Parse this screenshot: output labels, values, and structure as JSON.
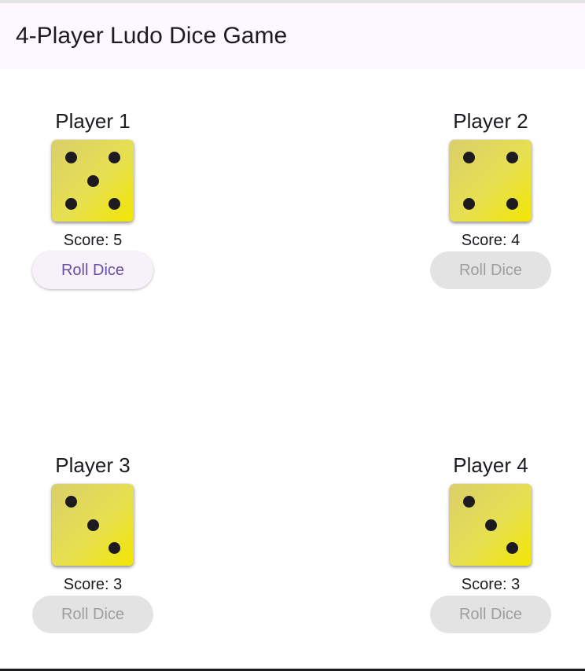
{
  "app": {
    "title": "4-Player Ludo Dice Game"
  },
  "players": [
    {
      "name": "Player 1",
      "die_value": 5,
      "score_text": "Score: 5",
      "button_label": "Roll Dice",
      "button_enabled": true
    },
    {
      "name": "Player 2",
      "die_value": 4,
      "score_text": "Score: 4",
      "button_label": "Roll Dice",
      "button_enabled": false
    },
    {
      "name": "Player 3",
      "die_value": 3,
      "score_text": "Score: 3",
      "button_label": "Roll Dice",
      "button_enabled": false
    },
    {
      "name": "Player 4",
      "die_value": 3,
      "score_text": "Score: 3",
      "button_label": "Roll Dice",
      "button_enabled": false
    }
  ],
  "colors": {
    "app_bar_background": "#fdf7ff",
    "die_gradient_start": "#d9cf6a",
    "die_gradient_end": "#f2e600",
    "pip": "#1d1b20",
    "button_enabled_text": "#6750a4",
    "button_enabled_background": "#f7f2fa",
    "button_disabled_background": "#e3e3e3",
    "button_disabled_text": "#9e9e9e"
  }
}
